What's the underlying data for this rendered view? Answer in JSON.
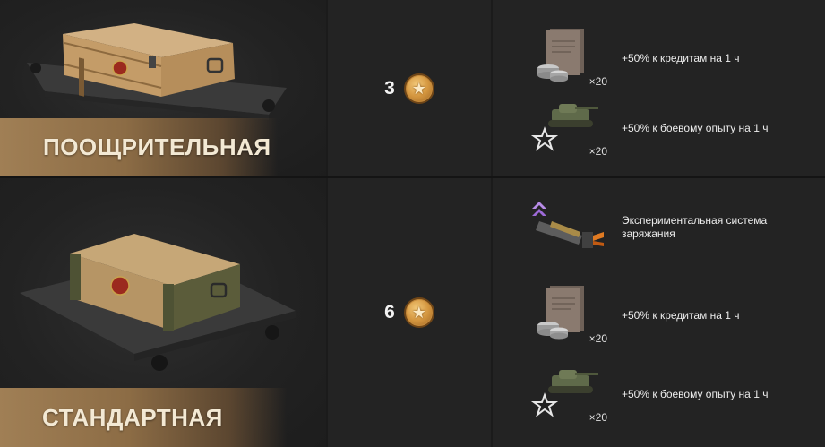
{
  "crates": [
    {
      "name": "ПООЩРИТЕЛЬНАЯ",
      "price": "3",
      "rewards": [
        {
          "icon": "credits-booster-icon",
          "multiplier": "×20",
          "text": "+50% к кредитам на 1 ч"
        },
        {
          "icon": "combat-xp-booster-icon",
          "multiplier": "×20",
          "text": "+50% к боевому опыту на 1 ч"
        }
      ]
    },
    {
      "name": "СТАНДАРТНАЯ",
      "price": "6",
      "rewards": [
        {
          "icon": "experimental-loading-system-icon",
          "multiplier": "",
          "text": "Экспериментальная система заряжания"
        },
        {
          "icon": "credits-booster-icon",
          "multiplier": "×20",
          "text": "+50% к кредитам на 1 ч"
        },
        {
          "icon": "combat-xp-booster-icon",
          "multiplier": "×20",
          "text": "+50% к боевому опыту на 1 ч"
        }
      ]
    }
  ],
  "colors": {
    "banner": "#9a7a50",
    "coin": "#d4963f",
    "background": "#232323"
  }
}
